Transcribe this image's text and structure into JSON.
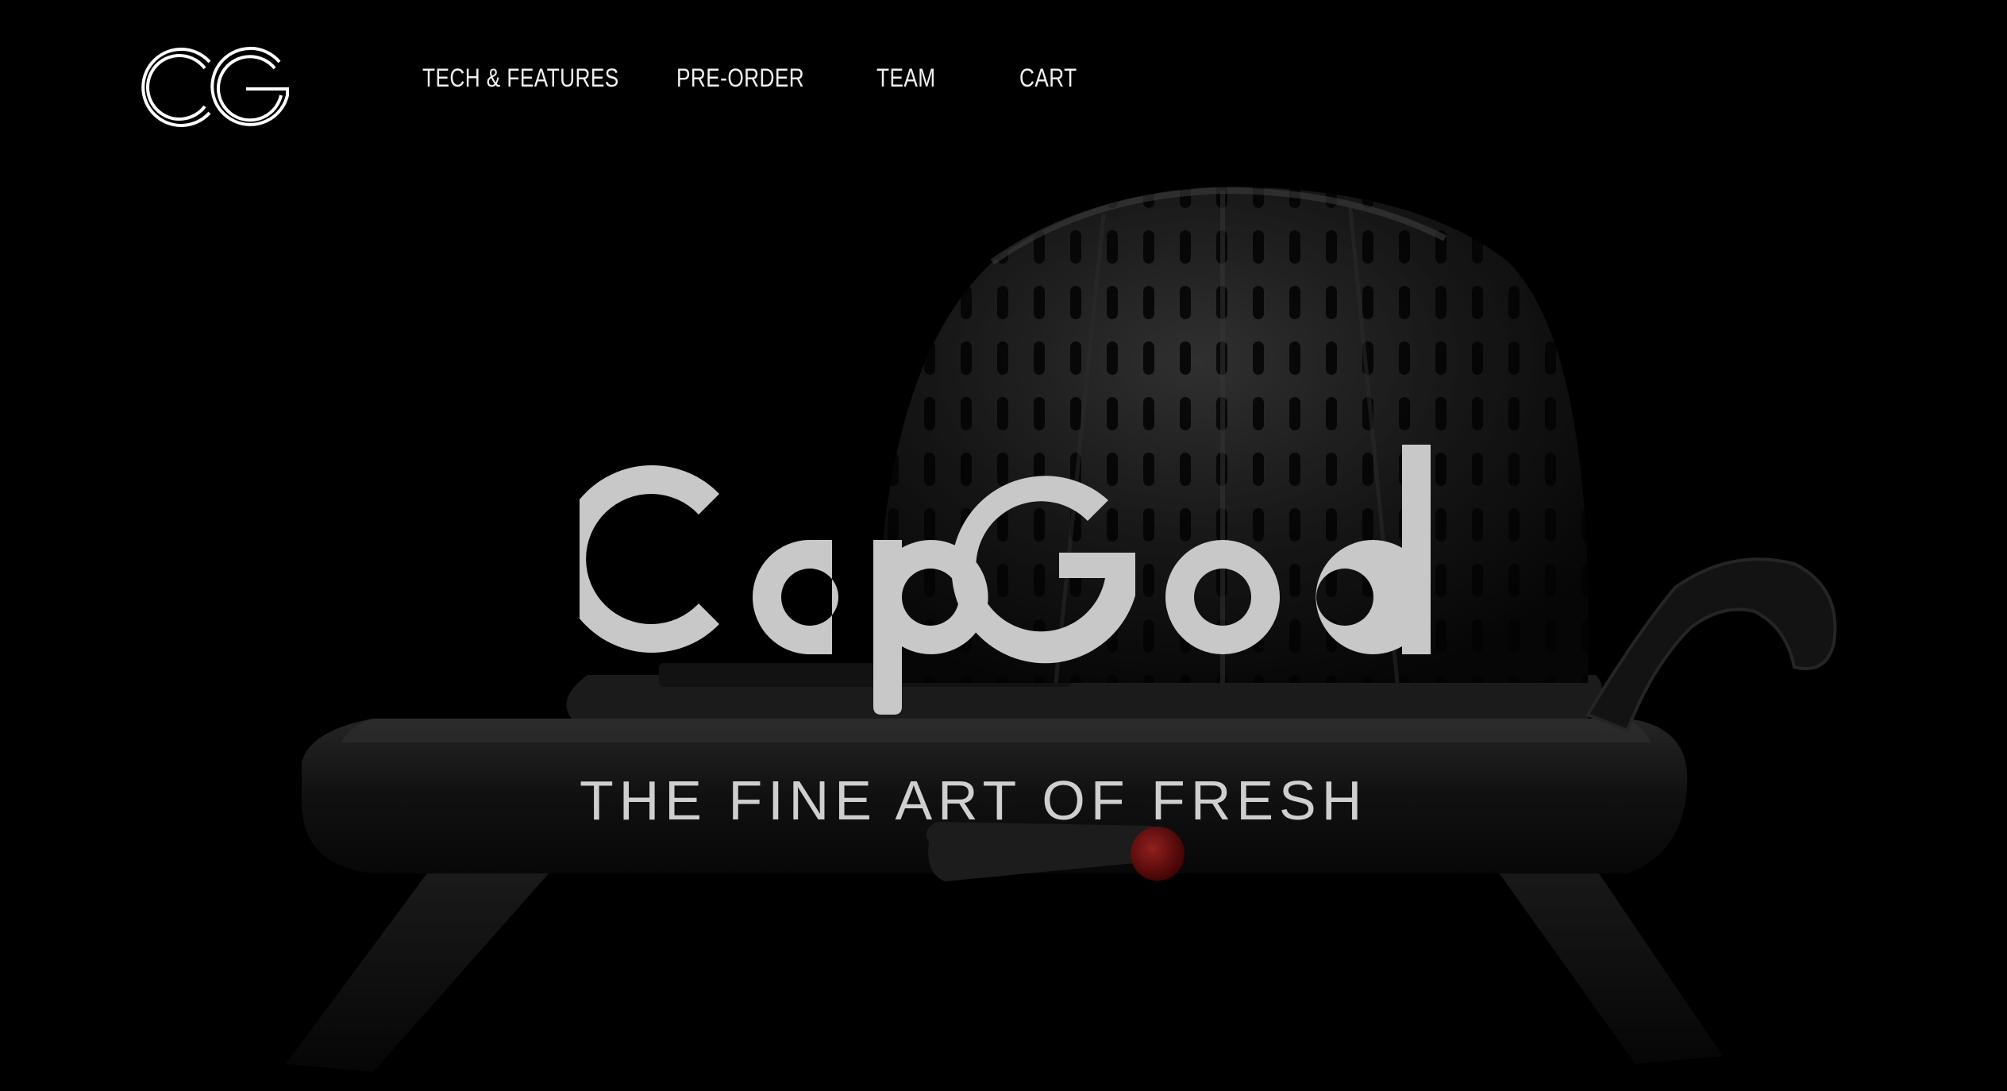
{
  "brand": {
    "logo_text": "CG",
    "wordmark": "CapGod",
    "tagline": "THE FINE ART OF FRESH"
  },
  "nav": {
    "items": [
      {
        "label": "TECH & FEATURES"
      },
      {
        "label": "PRE-ORDER"
      },
      {
        "label": "TEAM"
      },
      {
        "label": "CART"
      }
    ]
  },
  "hero": {
    "image": "capgod-device-product-shot",
    "background": "#000000",
    "accent": "#b01a1a"
  }
}
